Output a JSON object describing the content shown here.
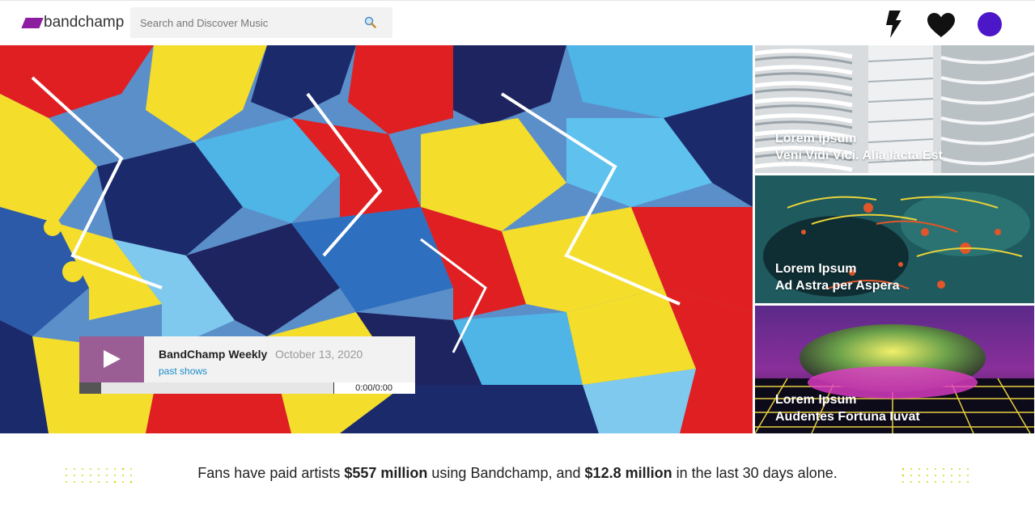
{
  "header": {
    "logo_text": "bandchamp",
    "search_placeholder": "Search and Discover Music",
    "icons": [
      "lightning-bolt-icon",
      "heart-icon",
      "user-avatar"
    ],
    "avatar_color": "#4b17c9",
    "logo_color": "#8c1ea0"
  },
  "player": {
    "title": "BandChamp Weekly",
    "date": "October 13, 2020",
    "past_shows": "past shows",
    "time": "0:00/0:00",
    "play_button_color": "#9a5e95",
    "link_color": "#1a8dc9"
  },
  "cards": [
    {
      "line1": "Lorem Ipsum",
      "line2": "Veni Vidi Vici. Alia Iacta Est"
    },
    {
      "line1": "Lorem Ipsum",
      "line2": "Ad Astra per Aspera"
    },
    {
      "line1": "Lorem Ipsum",
      "line2": "Audentes Fortuna Iuvat"
    }
  ],
  "stats": {
    "prefix": "Fans have paid artists ",
    "amount_total": "$557 million",
    "middle": " using Bandchamp, and ",
    "amount_recent": "$12.8 million",
    "suffix": " in the last 30 days alone."
  }
}
